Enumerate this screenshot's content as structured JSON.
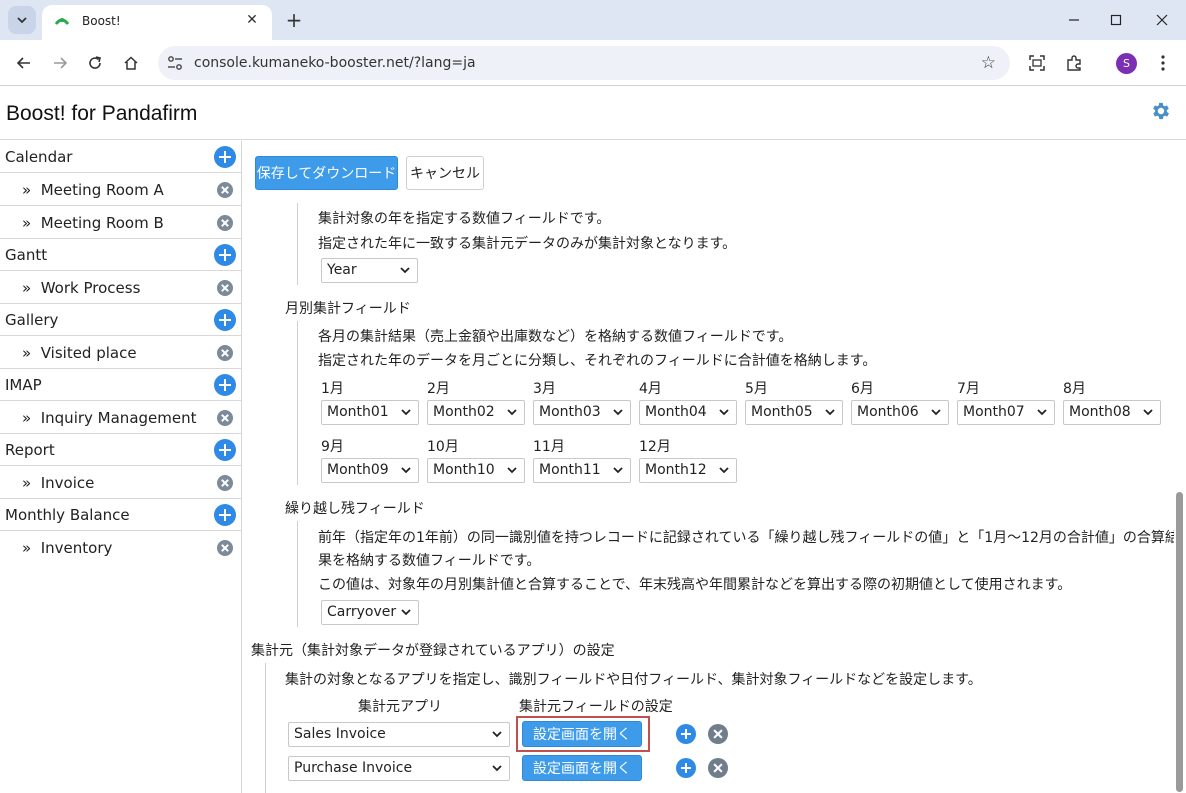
{
  "browser": {
    "tab_title": "Boost!",
    "url": "console.kumaneko-booster.net/?lang=ja",
    "profile_initial": "S"
  },
  "app": {
    "title": "Boost! for Pandafirm"
  },
  "sidebar": {
    "groups": [
      {
        "label": "Calendar",
        "items": [
          "Meeting Room A",
          "Meeting Room B"
        ]
      },
      {
        "label": "Gantt",
        "items": [
          "Work Process"
        ]
      },
      {
        "label": "Gallery",
        "items": [
          "Visited place"
        ]
      },
      {
        "label": "IMAP",
        "items": [
          "Inquiry Management"
        ]
      },
      {
        "label": "Report",
        "items": [
          "Invoice"
        ]
      },
      {
        "label": "Monthly Balance",
        "items": [
          "Inventory"
        ]
      }
    ],
    "item_prefix": "»"
  },
  "actions": {
    "save_download": "保存してダウンロード",
    "cancel": "キャンセル"
  },
  "year_field": {
    "desc1": "集計対象の年を指定する数値フィールドです。",
    "desc2": "指定された年に一致する集計元データのみが集計対象となります。",
    "value": "Year"
  },
  "monthly_field": {
    "heading": "月別集計フィールド",
    "desc1": "各月の集計結果（売上金額や出庫数など）を格納する数値フィールドです。",
    "desc2": "指定された年のデータを月ごとに分類し、それぞれのフィールドに合計値を格納します。",
    "months": [
      {
        "label": "1月",
        "value": "Month01"
      },
      {
        "label": "2月",
        "value": "Month02"
      },
      {
        "label": "3月",
        "value": "Month03"
      },
      {
        "label": "4月",
        "value": "Month04"
      },
      {
        "label": "5月",
        "value": "Month05"
      },
      {
        "label": "6月",
        "value": "Month06"
      },
      {
        "label": "7月",
        "value": "Month07"
      },
      {
        "label": "8月",
        "value": "Month08"
      },
      {
        "label": "9月",
        "value": "Month09"
      },
      {
        "label": "10月",
        "value": "Month10"
      },
      {
        "label": "11月",
        "value": "Month11"
      },
      {
        "label": "12月",
        "value": "Month12"
      }
    ]
  },
  "carryover_field": {
    "heading": "繰り越し残フィールド",
    "desc1": "前年（指定年の1年前）の同一識別値を持つレコードに記録されている「繰り越し残フィールドの値」と「1月～12月の合計値」の合算結",
    "desc2": "果を格納する数値フィールドです。",
    "desc3": "この値は、対象年の月別集計値と合算することで、年末残高や年間累計などを算出する際の初期値として使用されます。",
    "value": "Carryover"
  },
  "source": {
    "heading": "集計元（集計対象データが登録されているアプリ）の設定",
    "desc": "集計の対象となるアプリを指定し、識別フィールドや日付フィールド、集計対象フィールドなどを設定します。",
    "col_app": "集計元アプリ",
    "col_settings": "集計元フィールドの設定",
    "rows": [
      {
        "app": "Sales Invoice",
        "button": "設定画面を開く"
      },
      {
        "app": "Purchase Invoice",
        "button": "設定画面を開く"
      }
    ]
  }
}
